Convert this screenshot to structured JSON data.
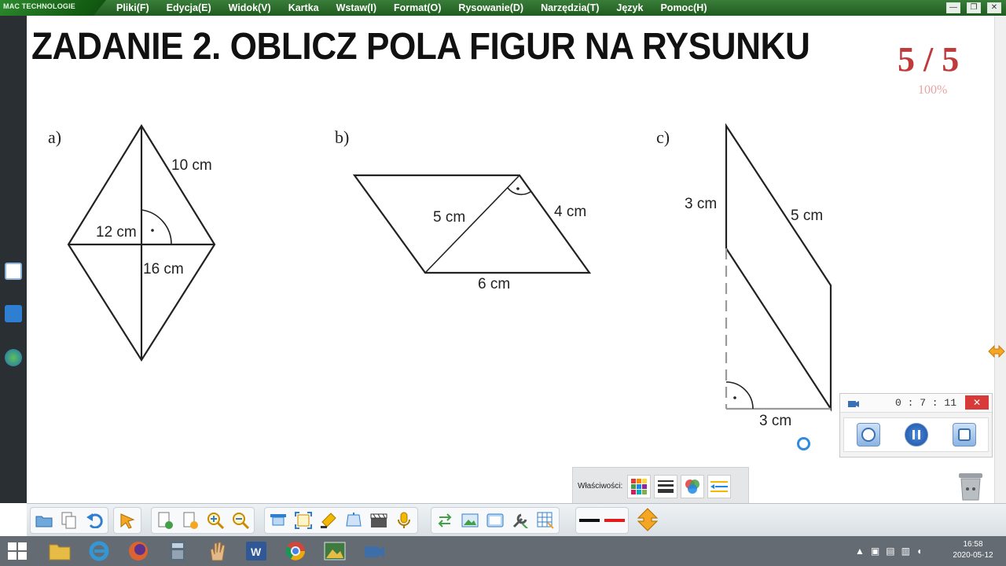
{
  "app": {
    "brand": "MAC TECHNOLOGIE",
    "menu": [
      "Pliki(F)",
      "Edycja(E)",
      "Widok(V)",
      "Kartka",
      "Wstaw(I)",
      "Format(O)",
      "Rysowanie(D)",
      "Narzędzia(T)",
      "Język",
      "Pomoc(H)"
    ]
  },
  "page": {
    "title": "ZADANIE 2. OBLICZ POLA FIGUR NA RYSUNKU",
    "score": "5 / 5",
    "percent": "100%"
  },
  "figures": {
    "a": {
      "label": "a)",
      "side": "10 cm",
      "half_diag": "12 cm",
      "diag": "16 cm"
    },
    "b": {
      "label": "b)",
      "diag": "5 cm",
      "side": "4 cm",
      "base": "6 cm"
    },
    "c": {
      "label": "c)",
      "height": "3 cm",
      "slant": "5 cm",
      "base": "3 cm"
    }
  },
  "timer": {
    "time": "0 : 7 : 11",
    "close": "✕"
  },
  "properties": {
    "label": "Właściwości:"
  },
  "clock": {
    "time": "16:58",
    "date": "2020-05-12"
  },
  "colors": {
    "accent_green": "#2d8a2d",
    "score_red": "#c0393b"
  }
}
